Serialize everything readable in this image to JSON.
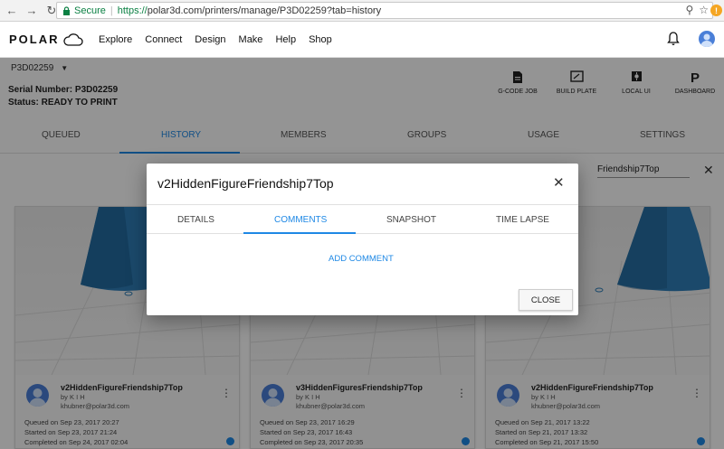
{
  "browser": {
    "secure_label": "Secure",
    "url_https": "https://",
    "url_rest": "polar3d.com/printers/manage/P3D02259?tab=history"
  },
  "app": {
    "logo_text": "POLAR",
    "nav": [
      "Explore",
      "Connect",
      "Design",
      "Make",
      "Help",
      "Shop"
    ]
  },
  "printer": {
    "id": "P3D02259",
    "serial": "Serial Number: P3D02259",
    "status": "Status: READY TO PRINT",
    "tools": [
      {
        "label": "G-CODE JOB",
        "icon": "file-icon"
      },
      {
        "label": "BUILD PLATE",
        "icon": "build-plate-icon"
      },
      {
        "label": "LOCAL UI",
        "icon": "local-ui-icon"
      },
      {
        "label": "DASHBOARD",
        "icon": "dashboard-icon",
        "glyph": "P"
      }
    ],
    "tabs": [
      "QUEUED",
      "HISTORY",
      "MEMBERS",
      "GROUPS",
      "USAGE",
      "SETTINGS"
    ],
    "active_tab": "HISTORY",
    "search_value": "Friendship7Top"
  },
  "cards": [
    {
      "title": "v2HiddenFigureFriendship7Top",
      "by": "by K I H",
      "email": "khubner@polar3d.com",
      "queued": "Queued on Sep 23, 2017 20:27",
      "started": "Started on Sep 23, 2017 21:24",
      "completed": "Completed on Sep 24, 2017 02:04"
    },
    {
      "title": "v3HiddenFiguresFriendship7Top",
      "by": "by K I H",
      "email": "khubner@polar3d.com",
      "queued": "Queued on Sep 23, 2017 16:29",
      "started": "Started on Sep 23, 2017 16:43",
      "completed": "Completed on Sep 23, 2017 20:35"
    },
    {
      "title": "v2HiddenFigureFriendship7Top",
      "by": "by K I H",
      "email": "khubner@polar3d.com",
      "queued": "Queued on Sep 21, 2017 13:22",
      "started": "Started on Sep 21, 2017 13:32",
      "completed": "Completed on Sep 21, 2017 15:50"
    }
  ],
  "dialog": {
    "title": "v2HiddenFigureFriendship7Top",
    "tabs": [
      "DETAILS",
      "COMMENTS",
      "SNAPSHOT",
      "TIME LAPSE"
    ],
    "active_tab": "COMMENTS",
    "add_comment": "ADD COMMENT",
    "close_label": "CLOSE"
  },
  "colors": {
    "accent": "#1e88e5",
    "secure_green": "#0b8043",
    "model_blue": "#2f7fb8"
  }
}
